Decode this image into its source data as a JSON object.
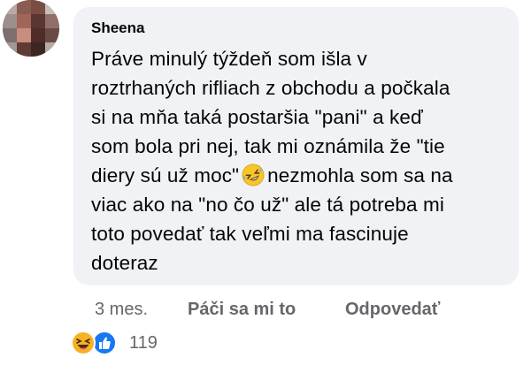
{
  "comment": {
    "author": "Sheena",
    "lines": [
      "Práve minulý týždeň som išla v",
      "roztrhaných rifliach z obchodu a počkala",
      "si na mňa taká postaršia \"pani\" a keď",
      "som bola pri nej, tak mi oznámila že \"tie",
      "diery sú už moc\"",
      "nezmohla som sa na",
      "viac ako na \"no čo už\" ale tá potreba mi",
      "toto povedať tak veľmi ma fascinuje",
      "doteraz"
    ],
    "inline_emoji": "rolling-on-floor-laughing"
  },
  "actions": {
    "time": "3 mes.",
    "like_label": "Páči sa mi to",
    "reply_label": "Odpovedať"
  },
  "reactions": {
    "icons": [
      "haha-reaction",
      "like-reaction"
    ],
    "count": "119"
  },
  "colors": {
    "bubble_bg": "#f0f2f5",
    "secondary_text": "#65676b",
    "like_blue": "#1877f2",
    "haha_yellow": "#f7b125"
  }
}
